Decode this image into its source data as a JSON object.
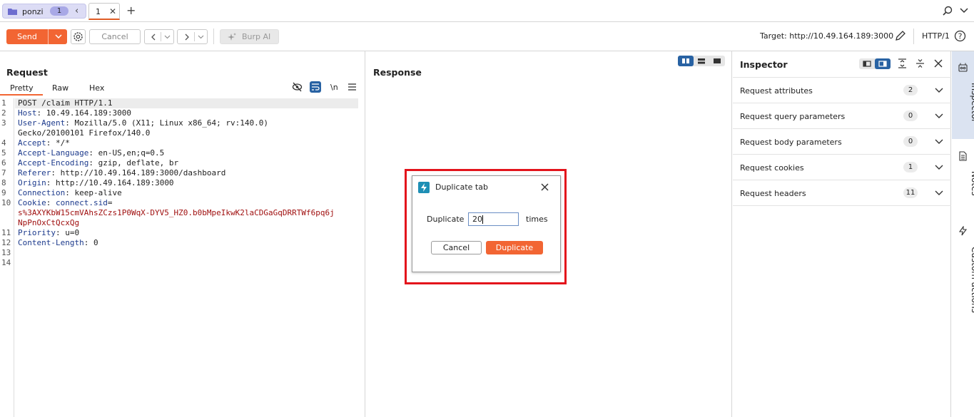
{
  "tabs": {
    "group_label": "ponzi",
    "group_count": "1",
    "prev": "‹",
    "tab_label": "1",
    "tab_close": "✕",
    "add": "+"
  },
  "toolbar": {
    "send": "Send",
    "cancel": "Cancel",
    "burp_ai": "Burp AI",
    "target": "Target: http://10.49.164.189:3000",
    "protocol": "HTTP/1"
  },
  "request": {
    "title": "Request",
    "tabs": [
      "Pretty",
      "Raw",
      "Hex"
    ],
    "newline_toggle": "\\n",
    "lines": [
      {
        "n": "1",
        "parts": [
          {
            "t": "POST /claim HTTP/1.1",
            "c": "plain"
          }
        ]
      },
      {
        "n": "2",
        "parts": [
          {
            "t": "Host",
            "c": "key"
          },
          {
            "t": ": 10.49.164.189:3000",
            "c": "plain"
          }
        ]
      },
      {
        "n": "3",
        "parts": [
          {
            "t": "User-Agent",
            "c": "key"
          },
          {
            "t": ": Mozilla/5.0 (X11; Linux x86_64; rv:140.0)",
            "c": "plain"
          }
        ]
      },
      {
        "n": "",
        "parts": [
          {
            "t": "Gecko/20100101 Firefox/140.0",
            "c": "plain"
          }
        ]
      },
      {
        "n": "4",
        "parts": [
          {
            "t": "Accept",
            "c": "key"
          },
          {
            "t": ": */*",
            "c": "plain"
          }
        ]
      },
      {
        "n": "5",
        "parts": [
          {
            "t": "Accept-Language",
            "c": "key"
          },
          {
            "t": ": en-US,en;q=0.5",
            "c": "plain"
          }
        ]
      },
      {
        "n": "6",
        "parts": [
          {
            "t": "Accept-Encoding",
            "c": "key"
          },
          {
            "t": ": gzip, deflate, br",
            "c": "plain"
          }
        ]
      },
      {
        "n": "7",
        "parts": [
          {
            "t": "Referer",
            "c": "key"
          },
          {
            "t": ": http://10.49.164.189:3000/dashboard",
            "c": "plain"
          }
        ]
      },
      {
        "n": "8",
        "parts": [
          {
            "t": "Origin",
            "c": "key"
          },
          {
            "t": ": http://10.49.164.189:3000",
            "c": "plain"
          }
        ]
      },
      {
        "n": "9",
        "parts": [
          {
            "t": "Connection",
            "c": "key"
          },
          {
            "t": ": keep-alive",
            "c": "plain"
          }
        ]
      },
      {
        "n": "10",
        "parts": [
          {
            "t": "Cookie",
            "c": "key"
          },
          {
            "t": ": ",
            "c": "plain"
          },
          {
            "t": "connect.sid",
            "c": "key"
          },
          {
            "t": "=",
            "c": "plain"
          }
        ]
      },
      {
        "n": "",
        "parts": [
          {
            "t": "s%3AXYKbW15cmVAhsZCzs1P0WqX-DYV5_HZ0.b0bMpeIkwK2laCDGaGqDRRTWf6pq6j",
            "c": "red"
          }
        ]
      },
      {
        "n": "",
        "parts": [
          {
            "t": "NpPnOxCtQcxQg",
            "c": "red"
          }
        ]
      },
      {
        "n": "11",
        "parts": [
          {
            "t": "Priority",
            "c": "key"
          },
          {
            "t": ": u=0",
            "c": "plain"
          }
        ]
      },
      {
        "n": "12",
        "parts": [
          {
            "t": "Content-Length",
            "c": "key"
          },
          {
            "t": ": 0",
            "c": "plain"
          }
        ]
      },
      {
        "n": "13",
        "parts": []
      },
      {
        "n": "14",
        "parts": []
      }
    ]
  },
  "response": {
    "title": "Response"
  },
  "inspector": {
    "title": "Inspector",
    "rows": [
      {
        "label": "Request attributes",
        "count": "2"
      },
      {
        "label": "Request query parameters",
        "count": "0"
      },
      {
        "label": "Request body parameters",
        "count": "0"
      },
      {
        "label": "Request cookies",
        "count": "1"
      },
      {
        "label": "Request headers",
        "count": "11"
      }
    ]
  },
  "sidebar": {
    "inspector": "Inspector",
    "notes": "Notes",
    "custom_actions": "Custom actions"
  },
  "dialog": {
    "title": "Duplicate tab",
    "label": "Duplicate",
    "value": "20",
    "suffix": "times",
    "cancel": "Cancel",
    "confirm": "Duplicate"
  },
  "colors": {
    "accent": "#f26533",
    "highlight": "#e3141c",
    "sidebar_active": "#dbe3f1",
    "tab_group": "#dcdcf5"
  }
}
